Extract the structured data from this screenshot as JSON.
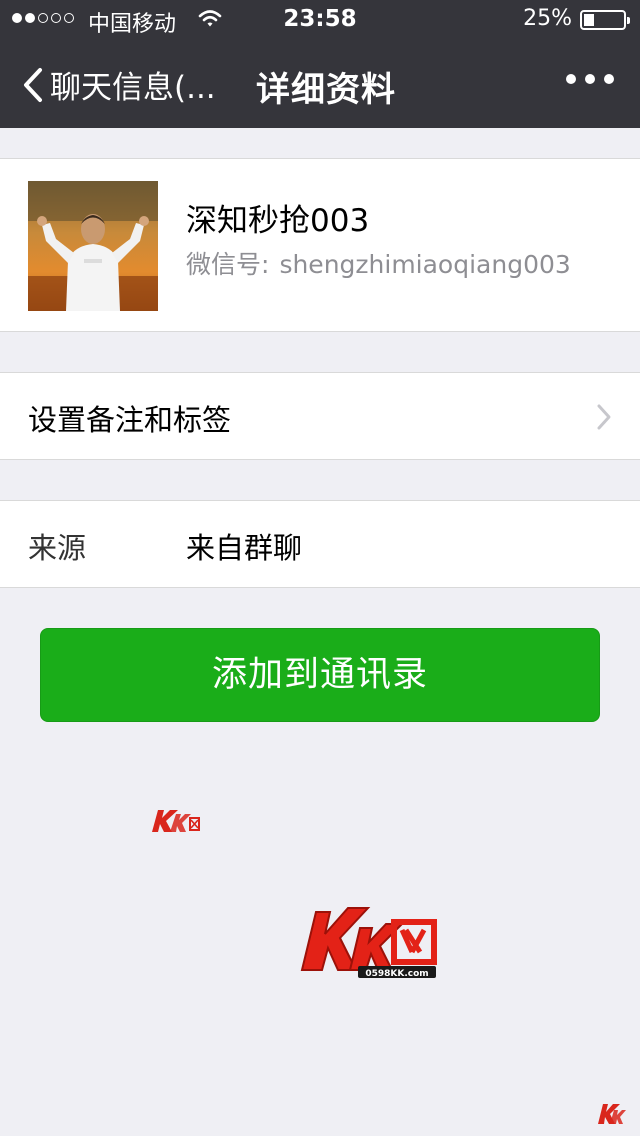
{
  "status_bar": {
    "carrier": "中国移动",
    "time": "23:58",
    "battery_percent_text": "25%",
    "battery_level": 0.25,
    "signal_strength": 2,
    "signal_total": 5
  },
  "nav": {
    "back_label": "聊天信息(...",
    "title": "详细资料"
  },
  "profile": {
    "name": "深知秒抢003",
    "wechat_id_label": "微信号:",
    "wechat_id": "shengzhimiaoqiang003"
  },
  "remark": {
    "label": "设置备注和标签"
  },
  "source": {
    "label": "来源",
    "value": "来自群聊"
  },
  "actions": {
    "add_contact_label": "添加到通讯录"
  },
  "watermark": {
    "text": "KK网",
    "url": "0598KK.com"
  },
  "colors": {
    "nav_background": "#35353b",
    "page_background": "#efeff4",
    "primary_button": "#1aad19",
    "secondary_text": "#8e8e93"
  }
}
